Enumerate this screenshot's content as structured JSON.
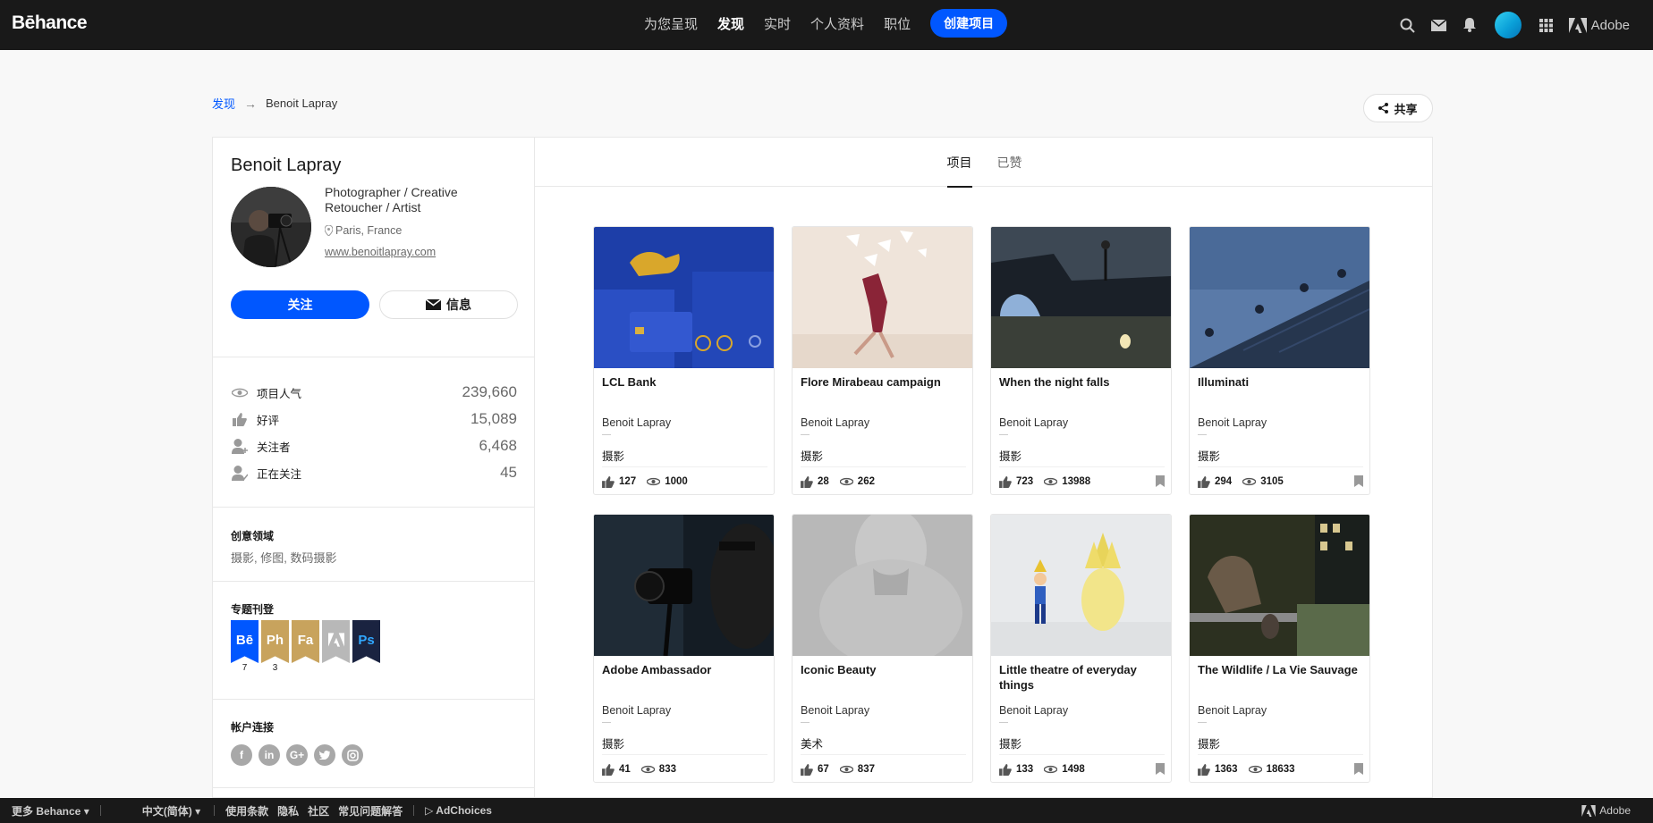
{
  "nav": {
    "logo": "Bēhance",
    "links": [
      "为您呈现",
      "发现",
      "实时",
      "个人资料",
      "职位"
    ],
    "active_link": "发现",
    "create_label": "创建项目",
    "adobe_label": "Adobe",
    "icons": [
      "search-icon",
      "mail-icon",
      "bell-icon",
      "avatar",
      "apps-grid-icon",
      "adobe-logo"
    ]
  },
  "breadcrumb": {
    "link": "发现",
    "arrow": "→",
    "current": "Benoit Lapray"
  },
  "share_label": "共享",
  "profile": {
    "name": "Benoit Lapray",
    "occupation": "Photographer / Creative Retoucher / Artist",
    "location": "Paris, France",
    "website": "www.benoitlapray.com",
    "follow_label": "关注",
    "message_label": "信息",
    "stats": [
      {
        "label": "项目人气",
        "value": "239,660",
        "icon": "eye-icon"
      },
      {
        "label": "好评",
        "value": "15,089",
        "icon": "thumbs-up-icon"
      },
      {
        "label": "关注者",
        "value": "6,468",
        "icon": "follower-icon"
      },
      {
        "label": "正在关注",
        "value": "45",
        "icon": "following-icon"
      }
    ],
    "creative_fields_title": "创意领域",
    "creative_fields": "摄影, 修图, 数码摄影",
    "featured_title": "专题刊登",
    "badges": [
      {
        "label": "Bē",
        "count": "7",
        "color": "#0057ff"
      },
      {
        "label": "Ph",
        "count": "3",
        "color": "#c8a35d"
      },
      {
        "label": "Fa",
        "count": "",
        "color": "#c8a35d"
      },
      {
        "label": "",
        "count": "",
        "color": "#b8b8b8",
        "icon": "adobe-icon"
      },
      {
        "label": "Ps",
        "count": "",
        "color": "#1a2340",
        "text_color": "#31a8ff"
      }
    ],
    "accounts_title": "帐户连接",
    "social": [
      "facebook-icon",
      "linkedin-icon",
      "google-plus-icon",
      "twitter-icon",
      "instagram-icon"
    ]
  },
  "tabs": [
    {
      "label": "项目",
      "active": true
    },
    {
      "label": "已赞",
      "active": false
    }
  ],
  "projects": [
    {
      "title": "LCL Bank",
      "owner": "Benoit Lapray",
      "field": "摄影",
      "likes": "127",
      "views": "1000",
      "bookmark": false
    },
    {
      "title": "Flore Mirabeau campaign",
      "owner": "Benoit Lapray",
      "field": "摄影",
      "likes": "28",
      "views": "262",
      "bookmark": false
    },
    {
      "title": "When the night falls",
      "owner": "Benoit Lapray",
      "field": "摄影",
      "likes": "723",
      "views": "13988",
      "bookmark": true
    },
    {
      "title": "Illuminati",
      "owner": "Benoit Lapray",
      "field": "摄影",
      "likes": "294",
      "views": "3105",
      "bookmark": true
    },
    {
      "title": "Adobe Ambassador",
      "owner": "Benoit Lapray",
      "field": "摄影",
      "likes": "41",
      "views": "833",
      "bookmark": false
    },
    {
      "title": "Iconic Beauty",
      "owner": "Benoit Lapray",
      "field": "美术",
      "likes": "67",
      "views": "837",
      "bookmark": false
    },
    {
      "title": "Little theatre of everyday things",
      "owner": "Benoit Lapray",
      "field": "摄影",
      "likes": "133",
      "views": "1498",
      "bookmark": true
    },
    {
      "title": "The Wildlife / La Vie Sauvage",
      "owner": "Benoit Lapray",
      "field": "摄影",
      "likes": "1363",
      "views": "18633",
      "bookmark": true
    }
  ],
  "footer": {
    "more": "更多 Behance",
    "language": "中文(简体)",
    "links": [
      "使用条款",
      "隐私",
      "社区",
      "常见问题解答"
    ],
    "adchoices": "AdChoices",
    "adobe": "Adobe"
  }
}
